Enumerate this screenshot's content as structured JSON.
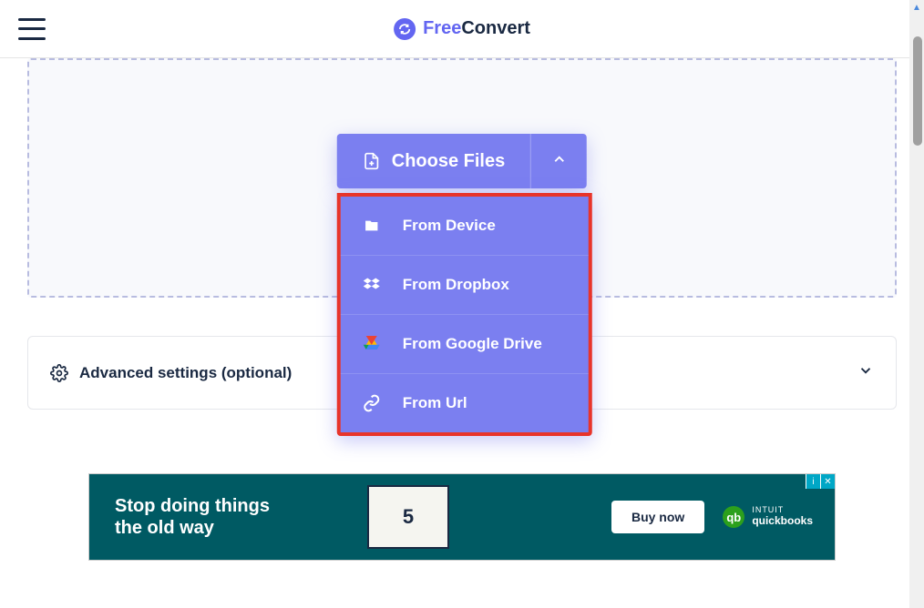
{
  "header": {
    "logo_free": "Free",
    "logo_convert": "Convert"
  },
  "upload": {
    "choose_label": "Choose Files",
    "options": [
      {
        "label": "From Device",
        "icon": "folder"
      },
      {
        "label": "From Dropbox",
        "icon": "dropbox"
      },
      {
        "label": "From Google Drive",
        "icon": "gdrive"
      },
      {
        "label": "From Url",
        "icon": "link"
      }
    ]
  },
  "advanced": {
    "label": "Advanced settings (optional)"
  },
  "ad": {
    "headline": "Stop doing things the old way",
    "number": "5",
    "cta": "Buy now",
    "brand_line1": "INTUIT",
    "brand_line2": "quickbooks",
    "brand_badge": "qb"
  },
  "colors": {
    "primary": "#7b7ff0",
    "highlight_border": "#e8342a",
    "ad_bg": "#005a63",
    "qb_green": "#2ca01c"
  }
}
